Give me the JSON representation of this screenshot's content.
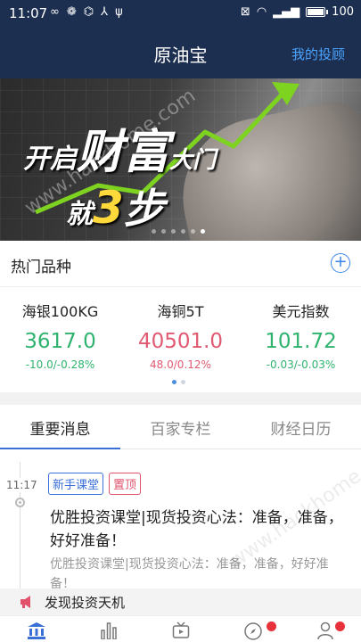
{
  "status_bar": {
    "time": "11:07",
    "battery": "100"
  },
  "header": {
    "title": "原油宝",
    "my_invest": "我的投顾"
  },
  "banner": {
    "line1_part1": "开启",
    "line1_big": "财富",
    "line1_part2": "大门",
    "line2_part1": "就",
    "line2_num": "3",
    "line2_big": "步",
    "slides": 6,
    "active_slide": 6
  },
  "hot": {
    "title": "热门品种",
    "items": [
      {
        "name": "海银100KG",
        "price": "3617.0",
        "change": "-10.0/-0.28%",
        "trend": "down"
      },
      {
        "name": "海铜5T",
        "price": "40501.0",
        "change": "48.0/0.12%",
        "trend": "up"
      },
      {
        "name": "美元指数",
        "price": "101.72",
        "change": "-0.03/-0.03%",
        "trend": "down"
      }
    ],
    "pages": 2,
    "active_page": 1
  },
  "tabs": [
    {
      "label": "重要消息",
      "active": true
    },
    {
      "label": "百家专栏",
      "active": false
    },
    {
      "label": "财经日历",
      "active": false
    }
  ],
  "feed": {
    "time": "11:17",
    "tags": [
      {
        "label": "新手课堂",
        "color": "blue"
      },
      {
        "label": "置顶",
        "color": "red"
      }
    ],
    "headline": "优胜投资课堂|现货投资心法：准备，准备，好好准备！",
    "summary": "优胜投资课堂|现货投资心法：准备，准备，好好准备！"
  },
  "announcement": {
    "text": "发现投资天机"
  },
  "watermark": "www.hackhome.com",
  "colors": {
    "header_bg": "#1d2f50",
    "accent_blue": "#3a6fd8",
    "down_green": "#2fb36e",
    "up_red": "#e05a72"
  }
}
